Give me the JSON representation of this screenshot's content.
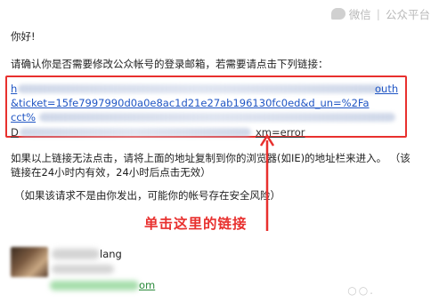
{
  "watermark": {
    "brand": "微信",
    "divider": "|",
    "platform": "公众平台"
  },
  "email": {
    "greeting": "你好!",
    "instruction": "请确认你是否需要修改公众帐号的登录邮箱，若需要请点击下列链接：",
    "link": {
      "line1_visible": "outh",
      "line2": "&ticket=15fe7997990d0a0e8ac1d21e27ab196130fc0ed&d_un=%2Fa",
      "line3": "cct%",
      "line4_suffix": "xm=error"
    },
    "fallback_text": "如果以上链接无法点击，请将上面的地址复制到你的浏览器(如IE)的地址栏来进入。 （该链接在24小时内有效，24小时后点击无效）",
    "security_note": "（如果该请求不是由你发出，可能你的帐号存在安全风险）",
    "annotation": "单击这里的链接",
    "sender": {
      "name_suffix": "lang",
      "email_suffix": "om"
    }
  },
  "colors": {
    "annotation_red": "#e8302e",
    "link_blue": "#1f55c4"
  }
}
